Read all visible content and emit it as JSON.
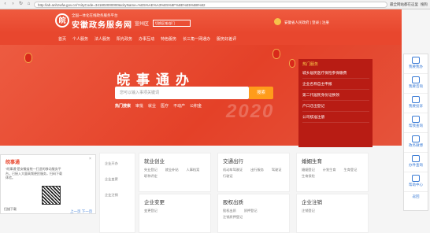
{
  "browser": {
    "url": "http://ah.anhzwfw.gov.cn/?cityCode=341802000000&cityName=%E5%AE%A3%E5%9F%8E%E5%B8%82",
    "search_hint": "最全网站都在这里",
    "side_hint": "搜狗"
  },
  "header": {
    "slogan": "全国一体化在线政务服务平台",
    "site_name": "安徽政务服务网",
    "region_label": "宣州区",
    "region_select": "切换区域/部门",
    "user_text": "安徽省人民政府",
    "login": "登录",
    "register": "注册"
  },
  "nav": [
    "首页",
    "个人服务",
    "法人服务",
    "阳光政务",
    "办事互动",
    "特色服务",
    "长三角一网通办",
    "服务好差评"
  ],
  "banner": {
    "title": "皖事通办",
    "search_placeholder": "您可以输入事项关键词",
    "search_button": "搜索",
    "hot_label": "热门搜索",
    "hot_words": [
      "审批",
      "就业",
      "医疗",
      "不动产",
      "公积金"
    ],
    "year": "2020"
  },
  "hot_services": {
    "title": "热门服务",
    "items": [
      "城乡居民医疗保险参保缴费",
      "企业名称自主申报",
      "第二代居民身份证换领",
      "户口迁出登记",
      "公司核准注册"
    ]
  },
  "cards": [
    {
      "title": "就业创业",
      "items": [
        "失业登记",
        "就业补贴",
        "人事档案",
        "职称评定"
      ]
    },
    {
      "title": "交通出行",
      "items": [
        "机动车驾驶证",
        "出行服务",
        "驾驶证",
        "行驶证"
      ]
    },
    {
      "title": "婚姻生育",
      "items": [
        "婚姻登记",
        "计划生育",
        "生育登记",
        "生育保险"
      ]
    },
    {
      "title": "企业变更",
      "items": [
        "变更登记"
      ]
    },
    {
      "title": "股权出质",
      "items": [
        "股权出质",
        "质押登记",
        "注销质押登记"
      ]
    },
    {
      "title": "企业注销",
      "items": [
        "注销登记"
      ]
    }
  ],
  "left_partial": {
    "items": [
      "企业开办",
      "企业变更",
      "企业注销"
    ]
  },
  "popup": {
    "title": "皖事通",
    "body": "“皖事通”是安徽省统一打造的移动服务平台，已接入大量高频便民服务，扫码下载体验。",
    "caption": "扫描下载",
    "pager": "上一页 下一页"
  },
  "side": [
    "我要我办",
    "我要咨询",
    "我要投诉",
    "帮我查询",
    "政务微博",
    "办件查询",
    "帮助中心",
    "返回"
  ],
  "colors": {
    "accent": "#e8472e",
    "hotbox": "#b81c14",
    "search_btn": "#ff9c1b",
    "link": "#3a7bd5"
  }
}
